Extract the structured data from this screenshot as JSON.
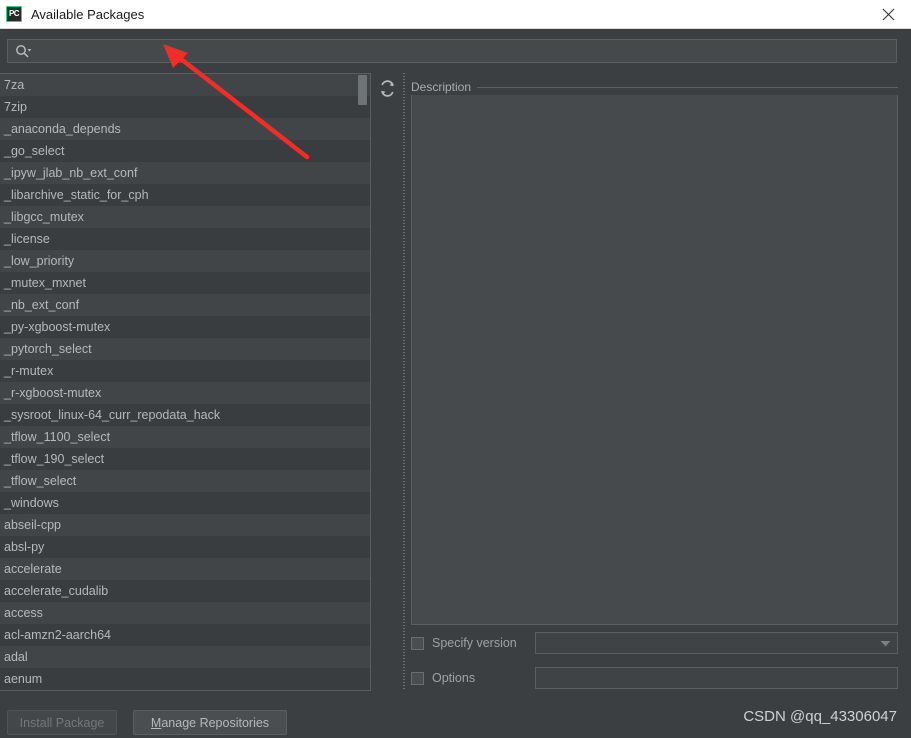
{
  "window": {
    "title": "Available Packages",
    "app_icon": "pycharm-icon",
    "app_icon_text": "PC",
    "close_icon": "close-icon"
  },
  "search": {
    "icon": "search-icon",
    "value": "",
    "placeholder": ""
  },
  "toolbar": {
    "refresh_icon": "refresh-icon"
  },
  "packages": {
    "scroll_position": "top",
    "items": [
      "7za",
      "7zip",
      "_anaconda_depends",
      "_go_select",
      "_ipyw_jlab_nb_ext_conf",
      "_libarchive_static_for_cph",
      "_libgcc_mutex",
      "_license",
      "_low_priority",
      "_mutex_mxnet",
      "_nb_ext_conf",
      "_py-xgboost-mutex",
      "_pytorch_select",
      "_r-mutex",
      "_r-xgboost-mutex",
      "_sysroot_linux-64_curr_repodata_hack",
      "_tflow_1100_select",
      "_tflow_190_select",
      "_tflow_select",
      "_windows",
      "abseil-cpp",
      "absl-py",
      "accelerate",
      "accelerate_cudalib",
      "access",
      "acl-amzn2-aarch64",
      "adal",
      "aenum"
    ]
  },
  "description": {
    "legend": "Description",
    "body": ""
  },
  "options": {
    "specify_version": {
      "label": "Specify version",
      "checked": false,
      "value": "",
      "dropdown_icon": "chevron-down-icon"
    },
    "options_field": {
      "label": "Options",
      "checked": false,
      "value": ""
    }
  },
  "buttons": {
    "install": {
      "label": "Install Package",
      "enabled": false
    },
    "manage": {
      "label_mnemonic": "M",
      "label_rest": "anage Repositories"
    }
  },
  "watermark": {
    "text": "CSDN @qq_43306047"
  },
  "annotation": {
    "arrow_color": "#f22c26",
    "points_to": "search-input"
  },
  "colors": {
    "dialog_bg": "#3c3f41",
    "list_row_alt": "#414548",
    "list_row_base": "#393d3f",
    "description_bg": "#464a4c",
    "text": "#b6b9ba",
    "border": "#5a5e60",
    "titlebar_bg": "#ffffff",
    "accent_green": "#21d789"
  }
}
